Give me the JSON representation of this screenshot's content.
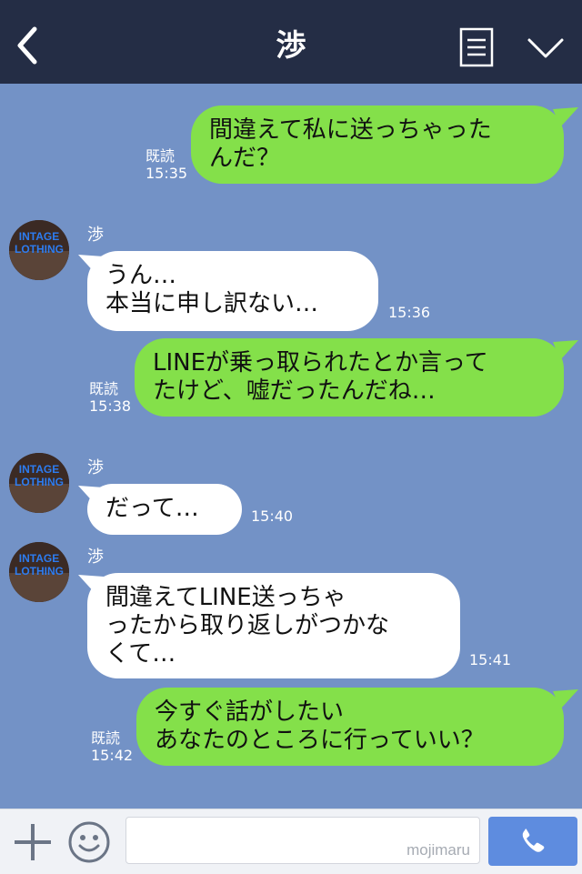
{
  "header": {
    "title": "渉",
    "back_icon": "chevron-left-icon",
    "menu_icon": "notes-icon",
    "collapse_icon": "chevron-down-icon",
    "bg_color": "#242d45"
  },
  "chat": {
    "bg_color": "#7392c6",
    "messages": [
      {
        "side": "me",
        "text": "間違えて私に送っちゃった\nんだ？",
        "read": "既読",
        "time": "15:35"
      },
      {
        "side": "them",
        "sender": "渉",
        "text": "うん…\n本当に申し訳ない…",
        "time": "15:36"
      },
      {
        "side": "me",
        "text": "LINEが乗っ取られたとか言って\nたけど、嘘だったんだね…",
        "read": "既読",
        "time": "15:38"
      },
      {
        "side": "them",
        "sender": "渉",
        "text": "だって…",
        "time": "15:40"
      },
      {
        "side": "them",
        "sender": "渉",
        "text": "間違えてLINE送っちゃ\nったから取り返しがつかな\nくて…",
        "time": "15:41"
      },
      {
        "side": "me",
        "text": "今すぐ話がしたい\nあなたのところに行っていい？",
        "read": "既読",
        "time": "15:42"
      }
    ],
    "avatar_text": "INTAGE LOTHING"
  },
  "composer": {
    "watermark": "mojimaru",
    "placeholder": "",
    "plus_icon": "plus-icon",
    "emoji_icon": "smiley-icon",
    "send_icon": "phone-icon",
    "send_color": "#5e8cdf"
  }
}
